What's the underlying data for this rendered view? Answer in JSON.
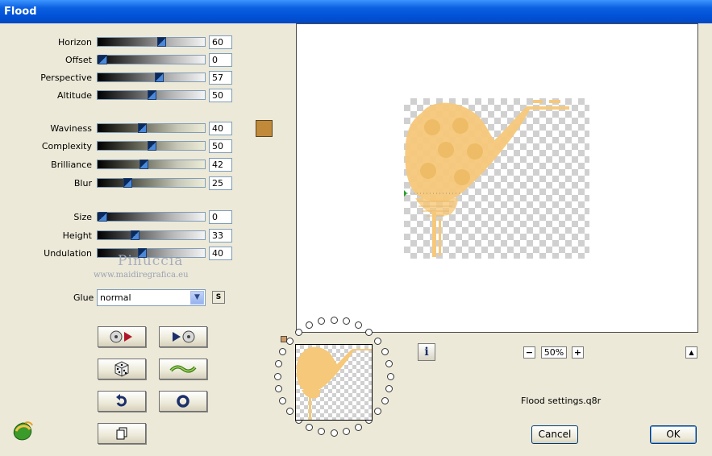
{
  "window": {
    "title": "Flood"
  },
  "sliders": [
    {
      "label": "Horizon",
      "value": "60",
      "pct": 60
    },
    {
      "label": "Offset",
      "value": "0",
      "pct": 0
    },
    {
      "label": "Perspective",
      "value": "57",
      "pct": 57
    },
    {
      "label": "Altitude",
      "value": "50",
      "pct": 50
    },
    {
      "label": "Waviness",
      "value": "40",
      "pct": 40
    },
    {
      "label": "Complexity",
      "value": "50",
      "pct": 50
    },
    {
      "label": "Brilliance",
      "value": "42",
      "pct": 42
    },
    {
      "label": "Blur",
      "value": "25",
      "pct": 25
    },
    {
      "label": "Size",
      "value": "0",
      "pct": 0
    },
    {
      "label": "Height",
      "value": "33",
      "pct": 33
    },
    {
      "label": "Undulation",
      "value": "40",
      "pct": 40
    }
  ],
  "color_swatch": "#c08a3a",
  "watermark": {
    "name": "Pinuccia",
    "site": "www.maidiregrafica.eu"
  },
  "glue": {
    "label": "Glue",
    "value": "normal",
    "s_label": "S"
  },
  "zoom": {
    "value": "50%",
    "minus": "−",
    "plus": "+"
  },
  "info_label": "i",
  "up_label": "▲",
  "settings_file": "Flood settings.q8r",
  "buttons": {
    "cancel": "Cancel",
    "ok": "OK"
  },
  "colors": {
    "titlebar": "#0251d6",
    "dialog_bg": "#ece9d8",
    "flood_fill": "#f6c87a"
  }
}
